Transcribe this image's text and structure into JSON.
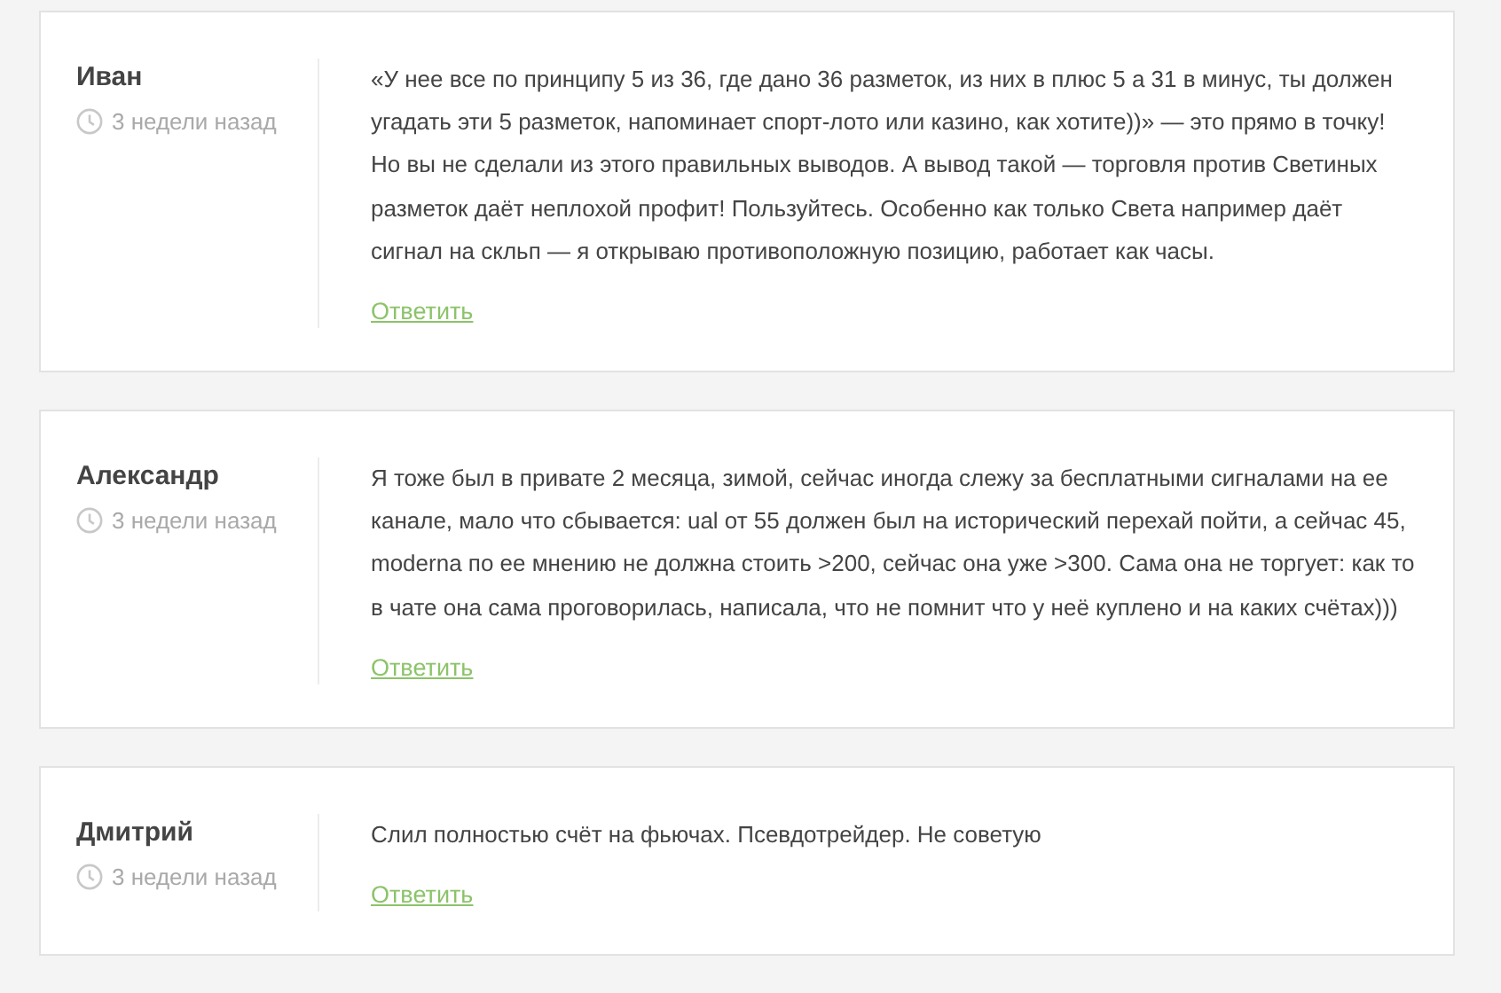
{
  "comments": [
    {
      "author": "Иван",
      "time": "3 недели назад",
      "text": "«У нее все по принципу 5 из 36, где дано 36 разметок, из них в плюс 5 а 31 в минус, ты должен угадать эти 5 разметок, напоминает спорт-лото или казино, как хотите))» — это прямо в точку! Но вы не сделали из этого правильных выводов. А вывод такой — торговля против Светиных разметок даёт неплохой профит! Пользуйтесь. Особенно как только Света например даёт сигнал на скльп — я открываю противоположную позицию, работает как часы.",
      "reply": "Ответить"
    },
    {
      "author": "Александр",
      "time": "3 недели назад",
      "text": "Я тоже был в привате 2 месяца, зимой, сейчас иногда слежу за бесплатными сигналами на ее канале, мало что сбывается: ual от 55 должен был на исторический перехай пойти, а сейчас 45, moderna по ее мнению не должна стоить >200, сейчас она уже >300. Сама она не торгует: как то в чате она сама проговорилась, написала, что не помнит что у неё куплено и на каких счётах)))",
      "reply": "Ответить"
    },
    {
      "author": "Дмитрий",
      "time": "3 недели назад",
      "text": "Слил полностью счёт на фьючах. Псевдотрейдер. Не советую",
      "reply": "Ответить"
    }
  ]
}
